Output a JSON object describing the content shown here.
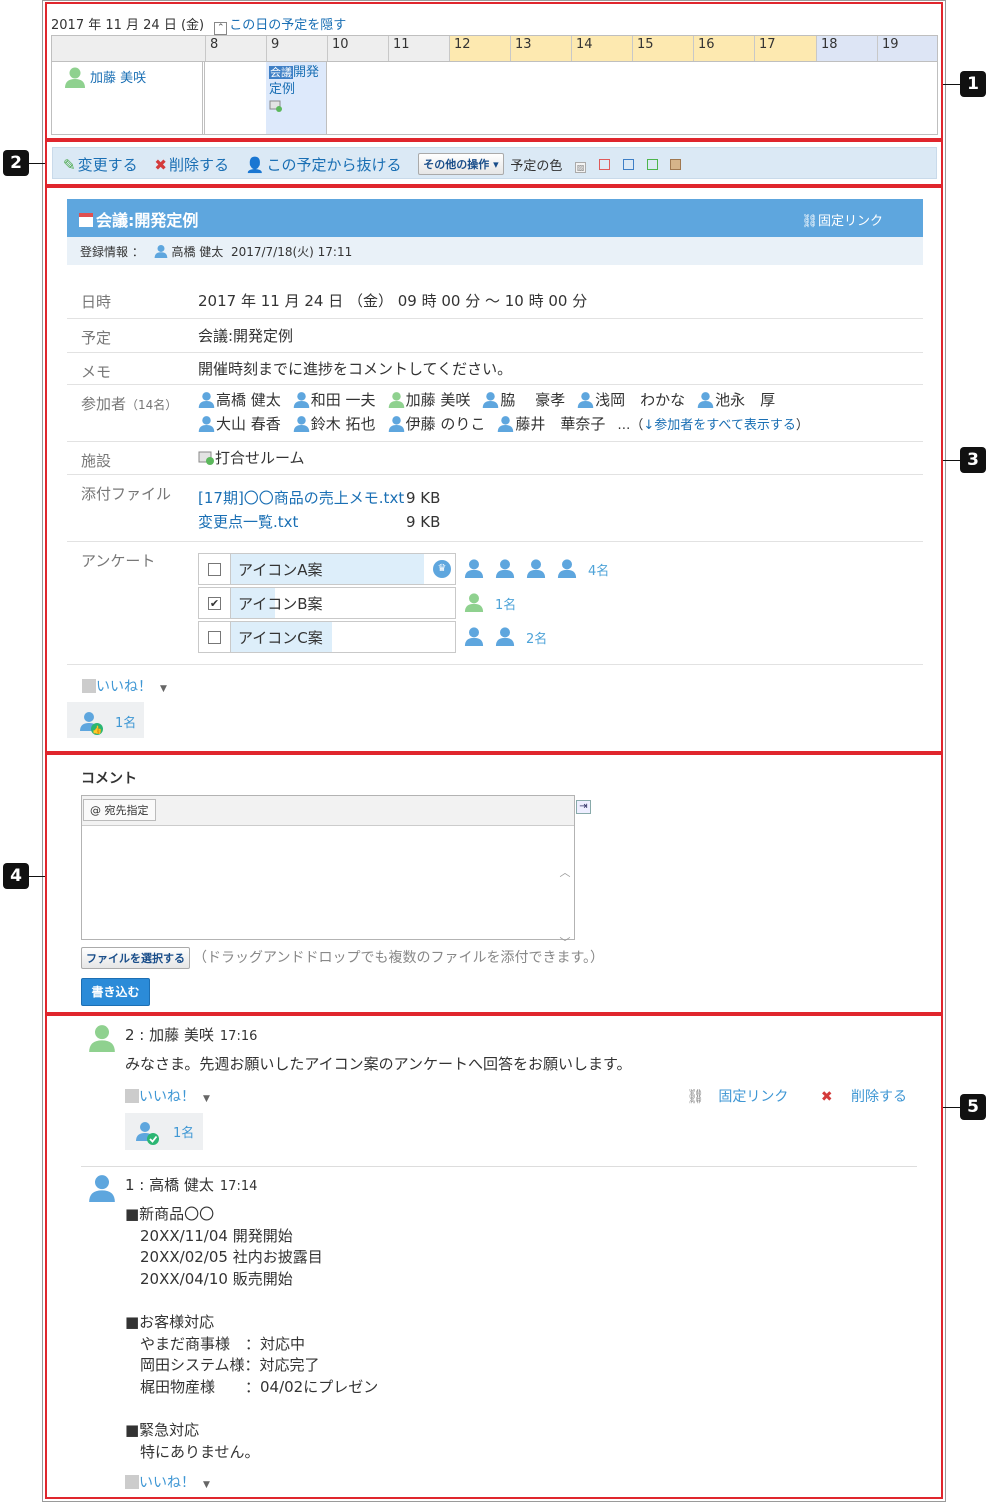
{
  "timeline": {
    "date": "2017 年 11 月 24 日 (金)",
    "hide_icon": "collapse-icon",
    "hide_link": "この日の予定を隠す",
    "hours": [
      "8",
      "9",
      "10",
      "11",
      "12",
      "13",
      "14",
      "15",
      "16",
      "17",
      "18",
      "19"
    ],
    "user": "加藤 美咲",
    "event_tag": "会議",
    "event_text": "開発定例"
  },
  "toolbar": {
    "edit": "変更する",
    "delete": "削除する",
    "leave": "この予定から抜ける",
    "more": "その他の操作",
    "more_icon": "chevron-down-icon",
    "color_label": "予定の色",
    "colors": [
      "#e05a5a",
      "#3e7fc6",
      "#4db54d",
      "#c39a6b"
    ]
  },
  "event": {
    "title": "会議:開発定例",
    "permalink": "固定リンク",
    "reg_label": "登録情報 ：",
    "reg_user": "高橋 健太",
    "reg_time": "2017/7/18(火) 17:11",
    "rows": {
      "datetime": {
        "label": "日時",
        "value": "2017 年 11 月 24 日 （金） 09 時 00 分 ～ 10 時 00 分"
      },
      "title": {
        "label": "予定",
        "value": "会議:開発定例"
      },
      "memo": {
        "label": "メモ",
        "value": "開催時刻までに進捗をコメントしてください。"
      },
      "attendees": {
        "label": "参加者",
        "count": "（14名）",
        "names": [
          "高橋 健太",
          "和田 一夫",
          "加藤 美咲",
          "脇　 豪孝",
          "浅岡　わかな",
          "池永　厚",
          "大山 春香",
          "鈴木 拓也",
          "伊藤 のりこ",
          "藤井　華奈子"
        ],
        "more_prefix": "…（",
        "more_link": "↓参加者をすべて表示する",
        "more_suffix": "）"
      },
      "facility": {
        "label": "施設",
        "value": "打合せルーム"
      },
      "files": {
        "label": "添付ファイル",
        "items": [
          {
            "name": "[17期]〇〇商品の売上メモ.txt",
            "size": "9 KB"
          },
          {
            "name": "変更点一覧.txt",
            "size": "9 KB"
          }
        ]
      },
      "survey": {
        "label": "アンケート",
        "options": [
          {
            "label": "アイコンA案",
            "checked": false,
            "votes": 4,
            "count_label": "4名",
            "fill": 0.86
          },
          {
            "label": "アイコンB案",
            "checked": true,
            "votes": 1,
            "count_label": "1名",
            "fill": 0.2
          },
          {
            "label": "アイコンC案",
            "checked": false,
            "votes": 2,
            "count_label": "2名",
            "fill": 0.45
          }
        ]
      }
    },
    "like_label": "いいね！",
    "like_count": "1名"
  },
  "comment_form": {
    "title": "コメント",
    "address_btn": "@ 宛先指定",
    "file_btn": "ファイルを選択する",
    "hint": "（ドラッグアンドドロップでも複数のファイルを添付できます。）",
    "submit": "書き込む"
  },
  "comments": [
    {
      "num": "2 : 加藤 美咲",
      "time": "17:16",
      "body": "みなさま。先週お願いしたアイコン案のアンケートへ回答をお願いします。",
      "like": "いいね！",
      "permalink": "固定リンク",
      "delete": "削除する",
      "like_count": "1名"
    },
    {
      "num": "1 : 高橋 健太",
      "time": "17:14",
      "body": "■新商品〇〇\n　20XX/11/04 開発開始\n　20XX/02/05 社内お披露目\n　20XX/04/10 販売開始\n\n■お客様対応\n　やまだ商事様　：対応中\n　岡田システム様：対応完了\n　梶田物産様　　：04/02にプレゼン\n\n■緊急対応\n　特にありません。",
      "like": "いいね！"
    }
  ],
  "badges": [
    "1",
    "2",
    "3",
    "4",
    "5"
  ]
}
